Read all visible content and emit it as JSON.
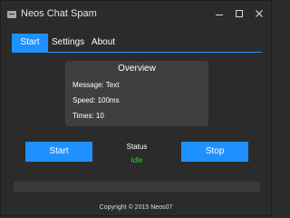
{
  "window": {
    "title": "Neos Chat Spam"
  },
  "tabs": {
    "start": "Start",
    "settings": "Settings",
    "about": "About"
  },
  "overview": {
    "title": "Overview",
    "message": "Message: Text",
    "speed": "Speed: 100ms",
    "times": "Times: 10"
  },
  "actions": {
    "start_label": "Start",
    "stop_label": "Stop"
  },
  "status": {
    "label": "Status",
    "value": "Idle"
  },
  "progress": {
    "value": 0
  },
  "footer": {
    "copyright": "Copyright © 2015 Neos07"
  },
  "colors": {
    "accent": "#1e90ff",
    "background": "#2b2b2b",
    "panel": "#3f3f3f",
    "status_idle": "#32cd32"
  },
  "icons": {
    "app": "app-icon",
    "minimize": "minimize-icon",
    "maximize": "maximize-icon",
    "close": "close-icon"
  }
}
